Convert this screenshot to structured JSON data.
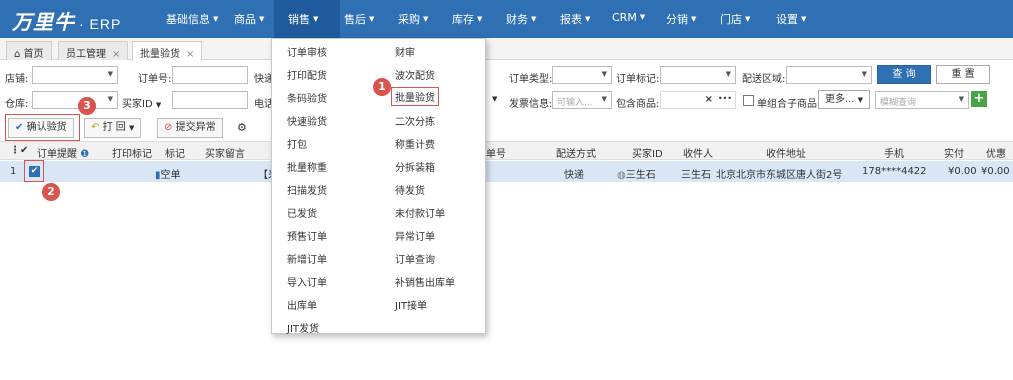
{
  "app": {
    "logo": "万里牛",
    "product": "· ERP"
  },
  "nav": [
    {
      "label": "基础信息"
    },
    {
      "label": "商品"
    },
    {
      "label": "销售"
    },
    {
      "label": "售后"
    },
    {
      "label": "采购"
    },
    {
      "label": "库存"
    },
    {
      "label": "财务"
    },
    {
      "label": "报表"
    },
    {
      "label": "CRM"
    },
    {
      "label": "分销"
    },
    {
      "label": "门店"
    },
    {
      "label": "设置"
    }
  ],
  "tabs": [
    {
      "label": "首页"
    },
    {
      "label": "员工管理"
    },
    {
      "label": "批量验货"
    }
  ],
  "tab_close": "×",
  "filters": {
    "store": "店铺:",
    "order_no": "订单号:",
    "express_prefix": "快递",
    "order_type": "订单类型:",
    "order_mark": "订单标记:",
    "delivery_area": "配送区域:",
    "query_btn": "查 询",
    "reset_btn": "重 置",
    "warehouse": "仓库:",
    "buyer_id": "买家ID",
    "phone_prefix": "电话",
    "invoice_info": "发票信息:",
    "invoice_placeholder": "可输入...",
    "contains_goods": "包含商品:",
    "combo_checkbox": "单组合子商品",
    "more": "更多...",
    "fuzzy_placeholder": "模糊查询",
    "clear_icon": "×",
    "more_icon": "•••",
    "plus": "+"
  },
  "toolbar": {
    "confirm": "确认验货",
    "print": "打 回",
    "submit_exception": "提交异常",
    "gear": "⚙"
  },
  "table": {
    "headers": [
      "订单提醒",
      "打印标记",
      "标记",
      "买家留言",
      "单号",
      "配送方式",
      "买家ID",
      "收件人",
      "收件地址",
      "手机",
      "实付",
      "优惠"
    ],
    "row": {
      "index": "1",
      "mark": "空单",
      "message": "【来",
      "delivery": "快递",
      "buyer_id": "三生石",
      "recipient": "三生石",
      "address": "北京北京市东城区唐人街2号",
      "phone": "178****4422",
      "paid": "¥0.00",
      "discount": "¥0.00"
    }
  },
  "menu": {
    "left": [
      "订单审核",
      "打印配货",
      "条码验货",
      "快速验货",
      "打包",
      "批量称重",
      "扫描发货",
      "已发货",
      "预售订单",
      "新增订单",
      "导入订单",
      "出库单",
      "JIT发货"
    ],
    "right": [
      "财审",
      "波次配货",
      "批量验货",
      "二次分拣",
      "称重计费",
      "分拆装箱",
      "待发货",
      "未付款订单",
      "异常订单",
      "订单查询",
      "补销售出库单",
      "JIT接单"
    ]
  },
  "badges": [
    "1",
    "2",
    "3"
  ],
  "colors": {
    "brand": "#2f6fb3",
    "annotation": "#d9534f",
    "selected_row": "#d8e6f6"
  }
}
